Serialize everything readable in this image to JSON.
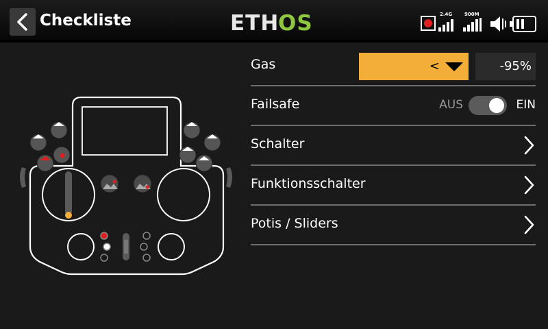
{
  "header": {
    "title": "Checkliste",
    "logo": {
      "text_white": "ETH",
      "text_green": "OS",
      "green": "#8dc63f"
    },
    "status": {
      "record_icon": "record-icon",
      "rssi_24_label": "2.4G",
      "rssi_900_label": "900M",
      "volume_icon": "speaker-icon",
      "battery_icon": "battery-icon"
    }
  },
  "rows": [
    {
      "label": "Gas",
      "select_value": "<",
      "value": "-95%"
    },
    {
      "label": "Failsafe",
      "toggle_off": "AUS",
      "toggle_on": "EIN",
      "state": true
    },
    {
      "label": "Schalter"
    },
    {
      "label": "Funktionsschalter"
    },
    {
      "label": "Potis / Sliders"
    }
  ],
  "colors": {
    "accent": "#f3ae3a",
    "background": "#1a1a1a",
    "switch_red": "#e02020",
    "throttle_dot": "#f3ae3a"
  }
}
